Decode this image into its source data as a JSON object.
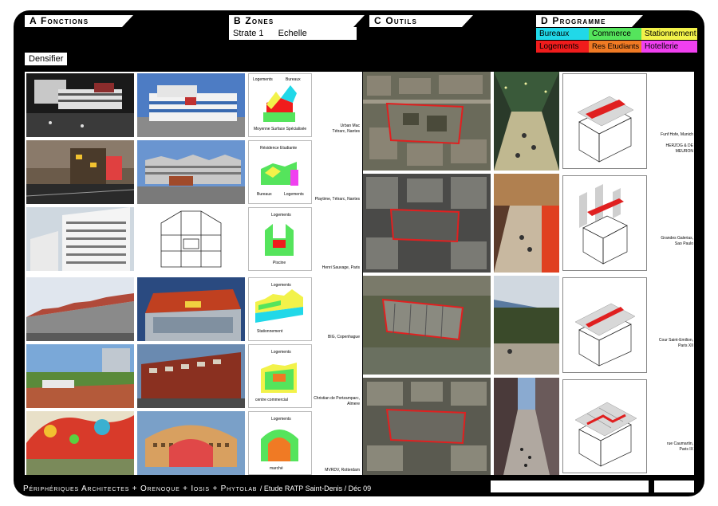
{
  "tabs": {
    "a": "A Fonctions",
    "b": "B Zones",
    "c": "C Outils",
    "d": "D Programme"
  },
  "zones": {
    "strate": "Strate 1",
    "echelle": "Echelle métropolitaine"
  },
  "fonctions": {
    "densifier": "Densifier"
  },
  "programme_legend": [
    {
      "label": "Bureaux",
      "color": "#21d8e8"
    },
    {
      "label": "Commerce",
      "color": "#55e45c"
    },
    {
      "label": "Stationnement",
      "color": "#f2f24a"
    },
    {
      "label": "Logements",
      "color": "#f01c1c"
    },
    {
      "label": "Res Etudiants",
      "color": "#f07a24"
    },
    {
      "label": "Hotellerie",
      "color": "#f040f0"
    }
  ],
  "references_left": [
    {
      "caption": "Urban Mac\nTétrarc, Nantes",
      "diagram": {
        "top_left": "Logements",
        "top_right": "Bureaux",
        "bottom": "Moyenne Surface Spécialisée"
      }
    },
    {
      "caption": "Playtime, Tétrarc, Nantes",
      "diagram": {
        "top": "Résidence Etudiante",
        "bottom_left": "Bureaux",
        "bottom_right": "Logements"
      }
    },
    {
      "caption": "Henri Sauvage, Paris",
      "diagram": {
        "top": "Logements",
        "bottom": "Piscine"
      }
    },
    {
      "caption": "BIG, Copenhague",
      "diagram": {
        "top": "Logements",
        "bottom": "Stationnement"
      }
    },
    {
      "caption": "Christian de Portzamparc,\nAlmere",
      "diagram": {
        "top": "Logements",
        "bottom": "centre commercial"
      }
    },
    {
      "caption": "MVRDV, Rotterdam",
      "diagram": {
        "top": "Logements",
        "bottom": "marché"
      }
    }
  ],
  "references_right": [
    {
      "caption": "Funf Hofe, Munich\n\nHERZOG & DE MEURON"
    },
    {
      "caption": "Grandes Galerias,\nSao Paulo"
    },
    {
      "caption": "Cour Saint-Emilion,\nParis XII"
    },
    {
      "caption": "rue Caumartin,\nParis IX"
    }
  ],
  "footer": {
    "credits": "Périphériques Architectes + Orenoque + Iosis + Phytolab",
    "project": "/ Etude RATP Saint-Denis /  Déc 09"
  }
}
